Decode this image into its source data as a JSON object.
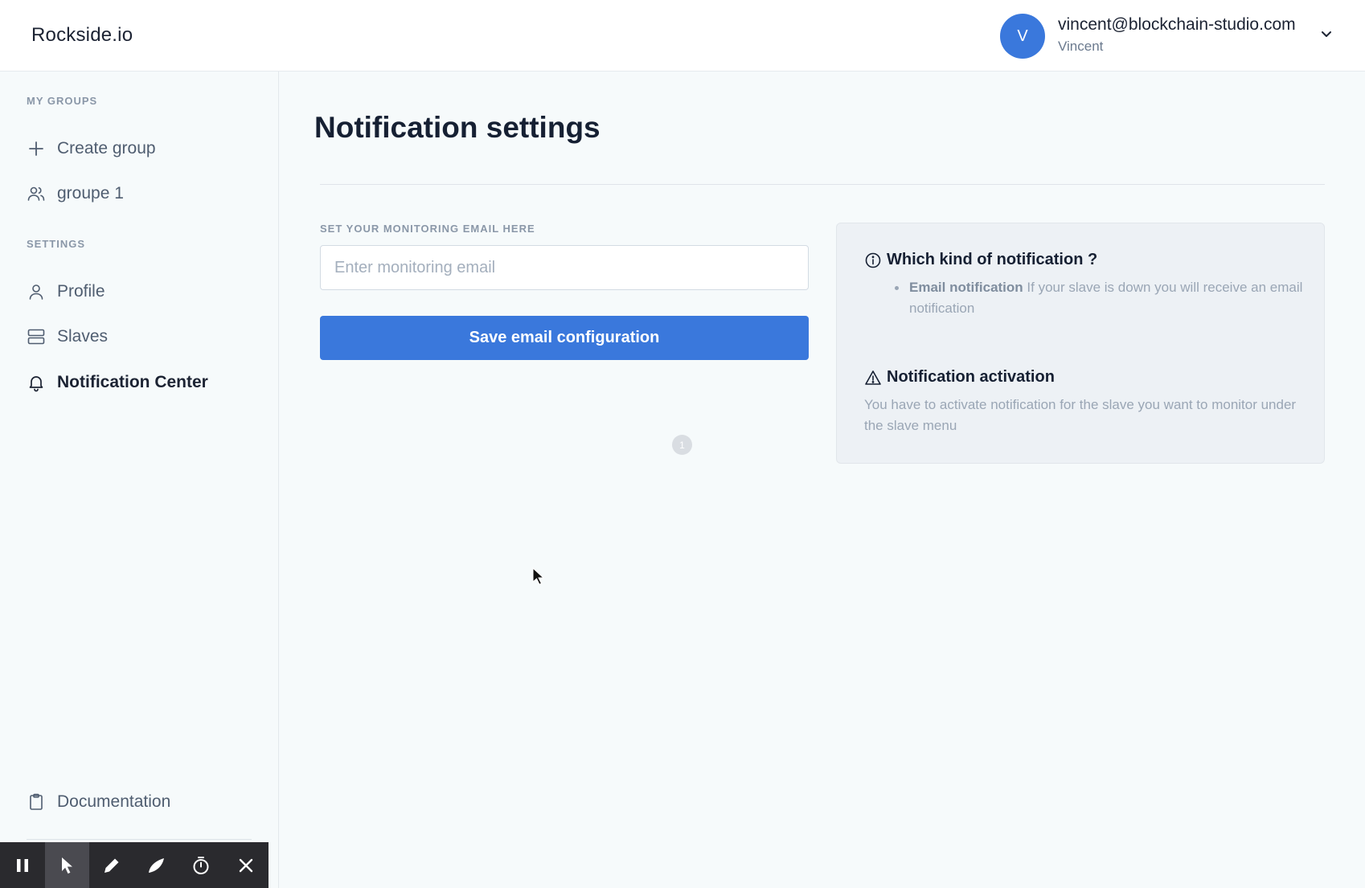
{
  "header": {
    "brand": "Rockside.io",
    "user": {
      "initial": "V",
      "email": "vincent@blockchain-studio.com",
      "name": "Vincent"
    }
  },
  "sidebar": {
    "groups_label": "MY GROUPS",
    "groups": [
      {
        "label": "Create group",
        "icon": "plus-icon"
      },
      {
        "label": "groupe 1",
        "icon": "users-icon"
      }
    ],
    "settings_label": "SETTINGS",
    "settings": [
      {
        "label": "Profile",
        "icon": "user-icon"
      },
      {
        "label": "Slaves",
        "icon": "server-icon"
      },
      {
        "label": "Notification Center",
        "icon": "bell-icon",
        "active": true
      }
    ],
    "documentation": {
      "label": "Documentation",
      "icon": "clipboard-icon"
    }
  },
  "toolbar": {
    "tools": [
      "pause-icon",
      "pointer-icon",
      "pencil-icon",
      "marker-icon",
      "timer-icon",
      "close-icon"
    ],
    "selected": "pointer-icon"
  },
  "main": {
    "title": "Notification settings",
    "email_label": "SET YOUR MONITORING EMAIL HERE",
    "email_value": "",
    "email_placeholder": "Enter monitoring email",
    "save_label": "Save email configuration",
    "badge": "1"
  },
  "info": {
    "kind_title": "Which kind of notification ?",
    "kind_item_bold": "Email notification",
    "kind_item_text": " If your slave is down you will receive an email notification",
    "activation_title": "Notification activation",
    "activation_text": "You have to activate notification for the slave you want to monitor under the slave menu"
  },
  "colors": {
    "accent": "#3a78dc",
    "background": "#f6fafb",
    "card": "#edf1f5",
    "muted_text": "#9aa6b5"
  }
}
